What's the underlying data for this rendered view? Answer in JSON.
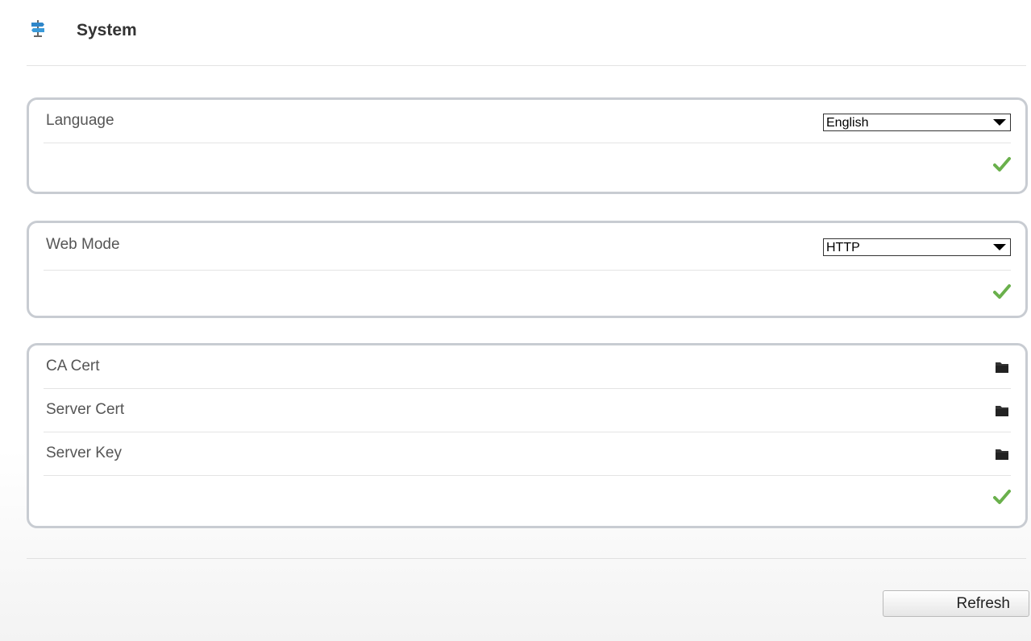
{
  "header": {
    "title": "System",
    "icon": "signpost-icon"
  },
  "language_panel": {
    "label": "Language",
    "selected": "English",
    "apply_icon": "checkmark-icon"
  },
  "web_mode_panel": {
    "label": "Web Mode",
    "selected": "HTTP",
    "apply_icon": "checkmark-icon"
  },
  "cert_panel": {
    "rows": [
      {
        "label": "CA Cert",
        "icon": "folder-icon"
      },
      {
        "label": "Server Cert",
        "icon": "folder-icon"
      },
      {
        "label": "Server Key",
        "icon": "folder-icon"
      }
    ],
    "apply_icon": "checkmark-icon"
  },
  "footer": {
    "refresh_label": "Refresh"
  },
  "colors": {
    "check": "#6ab04c",
    "panel_border": "#c8ccd2",
    "label": "#555555"
  }
}
